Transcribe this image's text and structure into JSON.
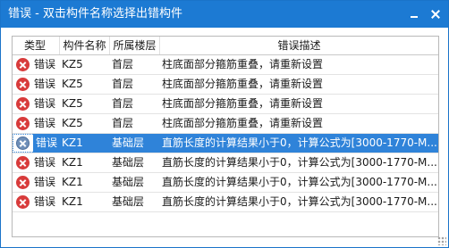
{
  "window": {
    "title": "错误 - 双击构件名称选择出错构件"
  },
  "columns": {
    "type": "类型",
    "name": "构件名称",
    "floor": "所属楼层",
    "desc": "错误描述"
  },
  "rows": [
    {
      "type": "错误",
      "name": "KZ5",
      "floor": "首层",
      "desc": "柱底面部分箍筋重叠，请重新设置",
      "icon": "error-icon"
    },
    {
      "type": "错误",
      "name": "KZ5",
      "floor": "首层",
      "desc": "柱底面部分箍筋重叠，请重新设置",
      "icon": "error-icon"
    },
    {
      "type": "错误",
      "name": "KZ5",
      "floor": "首层",
      "desc": "柱底面部分箍筋重叠，请重新设置",
      "icon": "error-icon"
    },
    {
      "type": "错误",
      "name": "KZ5",
      "floor": "首层",
      "desc": "柱底面部分箍筋重叠，请重新设置",
      "icon": "error-icon"
    },
    {
      "type": "错误",
      "name": "KZ1",
      "floor": "基础层",
      "desc": "直筋长度的计算结果小于0，计算公式为[3000-1770-M...",
      "icon": "error-icon",
      "selected": true
    },
    {
      "type": "错误",
      "name": "KZ1",
      "floor": "基础层",
      "desc": "直筋长度的计算结果小于0，计算公式为[3000-1770-M...",
      "icon": "error-icon"
    },
    {
      "type": "错误",
      "name": "KZ1",
      "floor": "基础层",
      "desc": "直筋长度的计算结果小于0，计算公式为[3000-1770-M...",
      "icon": "error-icon"
    },
    {
      "type": "错误",
      "name": "KZ1",
      "floor": "基础层",
      "desc": "直筋长度的计算结果小于0，计算公式为[3000-1770-M...",
      "icon": "error-icon"
    }
  ],
  "colors": {
    "titlebar": "#1c7ad3",
    "selection": "#2f83d9",
    "error_icon": "#d83b3b"
  }
}
